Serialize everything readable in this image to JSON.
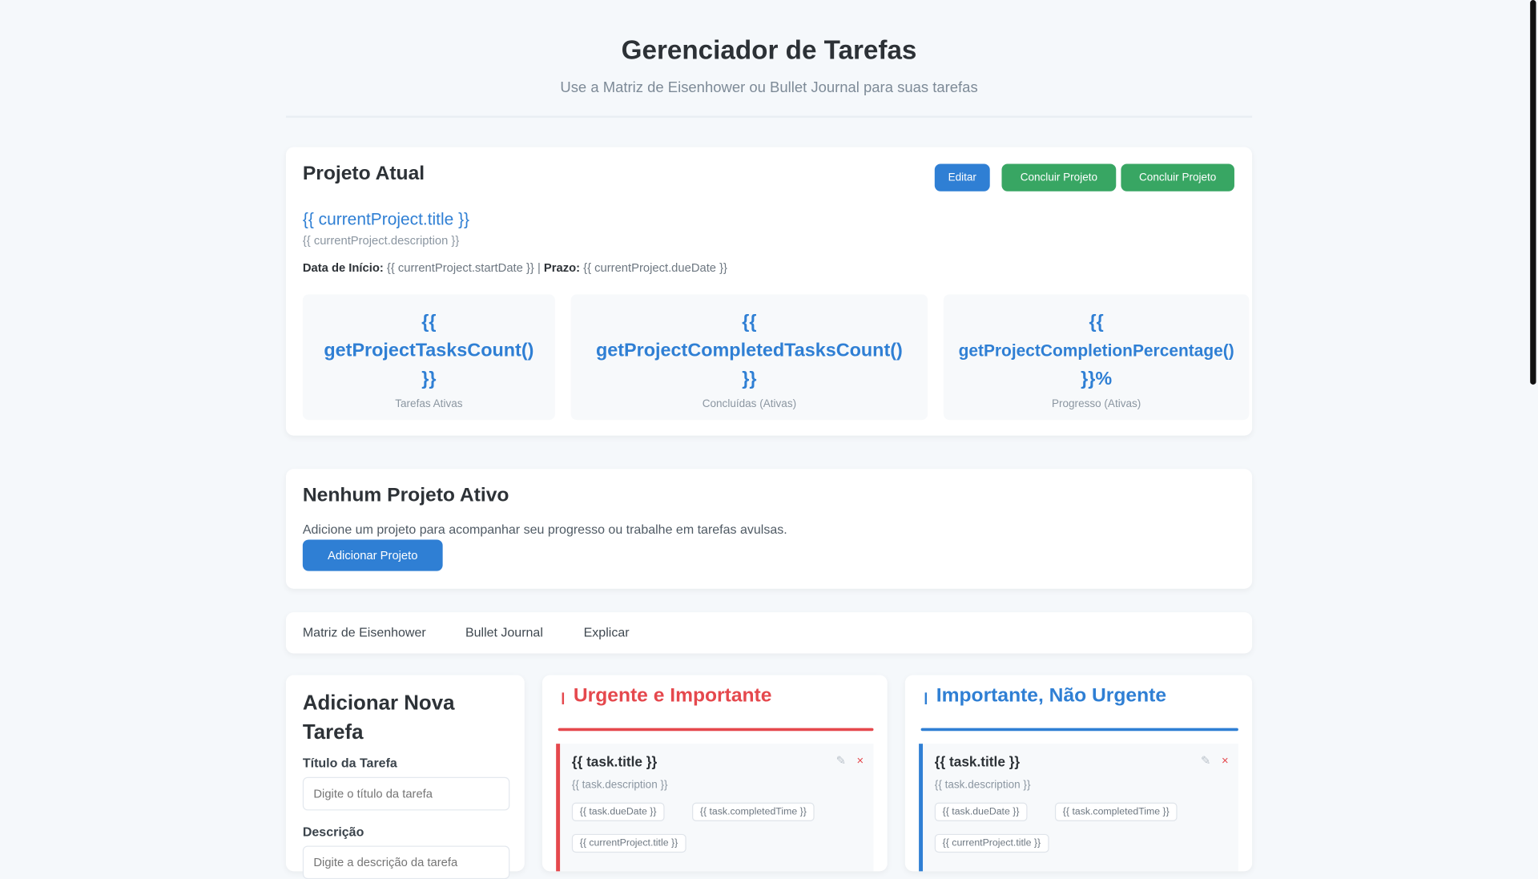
{
  "header": {
    "title": "Gerenciador de Tarefas",
    "subtitle": "Use a Matriz de Eisenhower ou Bullet Journal para suas tarefas"
  },
  "project": {
    "section_title": "Projeto Atual",
    "edit_label": "Editar",
    "btn_complete": "Concluir Projeto",
    "btn_complete2": "Concluir Projeto",
    "name": "{{ currentProject.title }}",
    "description": "{{ currentProject.description }}",
    "start_label": "Data de Início:",
    "start_value": "{{ currentProject.startDate }}",
    "deadline_label": "Prazo:",
    "deadline_value": "{{ currentProject.dueDate }}",
    "stats": [
      {
        "value_1": "{{",
        "value_2": "getProjectTasksCount()",
        "value_3": "}}",
        "label": "Tarefas Ativas"
      },
      {
        "value_1": "{{",
        "value_2": "getProjectCompletedTasksCount()",
        "value_3": "}}",
        "label": "Concluídas (Ativas)"
      },
      {
        "value_1": "{{",
        "value_2": "getProjectCompletionPercentage()",
        "value_3": "}}%",
        "label": "Progresso (Ativas)"
      }
    ]
  },
  "empty": {
    "title": "Nenhum Projeto Ativo",
    "text": "Adicione um projeto para acompanhar seu progresso ou trabalhe em tarefas avulsas.",
    "button": "Adicionar Projeto"
  },
  "tabs": [
    "Matriz de Eisenhower",
    "Bullet Journal",
    "Explicar"
  ],
  "form": {
    "title_line1": "Adicionar Nova",
    "title_line2": "Tarefa",
    "title_label": "Título da Tarefa",
    "title_placeholder": "Digite o título da tarefa",
    "desc_label": "Descrição",
    "desc_placeholder": "Digite a descrição da tarefa"
  },
  "quadrants": [
    {
      "title": "Urgente e Importante",
      "color": "#e5484d",
      "task_title": "{{ task.title }}",
      "task_desc": "{{ task.description }}",
      "chip_1": "{{ task.dueDate }}",
      "chip_2": "{{ task.completedTime }}",
      "chip_3": "{{ currentProject.title }}"
    },
    {
      "title": "Importante, Não Urgente",
      "color": "#2f7fd4",
      "task_title": "{{ task.title }}",
      "task_desc": "{{ task.description }}",
      "chip_1": "{{ task.dueDate }}",
      "chip_2": "{{ task.completedTime }}",
      "chip_3": "{{ currentProject.title }}"
    }
  ],
  "colors": {
    "accent": "#2f7fd4",
    "success": "#38a663",
    "danger": "#e5484d",
    "background": "#f5f8fb"
  }
}
